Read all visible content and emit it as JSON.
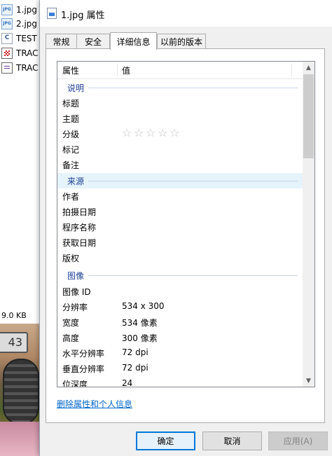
{
  "background": {
    "files": [
      {
        "name": "1.jpg",
        "icon": "jpg-file-icon"
      },
      {
        "name": "2.jpg",
        "icon": "jpg-file-icon"
      },
      {
        "name": "TEST",
        "icon": "c-source-file-icon"
      },
      {
        "name": "TRAC",
        "icon": "trac-file-icon"
      },
      {
        "name": "TRAC",
        "icon": "text-file-icon"
      }
    ],
    "size_text": "9.0 KB",
    "plate_text": "43"
  },
  "dialog": {
    "title": "1.jpg 属性",
    "tabs": [
      "常规",
      "安全",
      "详细信息",
      "以前的版本"
    ],
    "active_tab": "详细信息",
    "columns": {
      "property": "属性",
      "value": "值"
    },
    "groups": {
      "description": {
        "label": "说明",
        "rows": {
          "title": {
            "k": "标题",
            "v": ""
          },
          "subject": {
            "k": "主题",
            "v": ""
          },
          "rating": {
            "k": "分级",
            "stars": 0,
            "max": 5
          },
          "tags": {
            "k": "标记",
            "v": ""
          },
          "comments": {
            "k": "备注",
            "v": ""
          }
        }
      },
      "origin": {
        "label": "来源",
        "rows": {
          "author": {
            "k": "作者",
            "v": ""
          },
          "date_taken": {
            "k": "拍摄日期",
            "v": ""
          },
          "program": {
            "k": "程序名称",
            "v": ""
          },
          "date_acquired": {
            "k": "获取日期",
            "v": ""
          },
          "copyright": {
            "k": "版权",
            "v": ""
          }
        }
      },
      "image": {
        "label": "图像",
        "rows": {
          "image_id": {
            "k": "图像 ID",
            "v": ""
          },
          "dimensions": {
            "k": "分辨率",
            "v": "534 x 300"
          },
          "width": {
            "k": "宽度",
            "v": "534 像素"
          },
          "height": {
            "k": "高度",
            "v": "300 像素"
          },
          "hres": {
            "k": "水平分辨率",
            "v": "72 dpi"
          },
          "vres": {
            "k": "垂直分辨率",
            "v": "72 dpi"
          },
          "bit_depth": {
            "k": "位深度",
            "v": "24"
          }
        }
      }
    },
    "remove_link": "删除属性和个人信息",
    "buttons": {
      "ok": "确定",
      "cancel": "取消",
      "apply": "应用(A)"
    },
    "colors": {
      "accent": "#0078d7",
      "group_text": "#1e3f95",
      "link": "#0066cc",
      "highlight": "#e5f3fb"
    }
  }
}
